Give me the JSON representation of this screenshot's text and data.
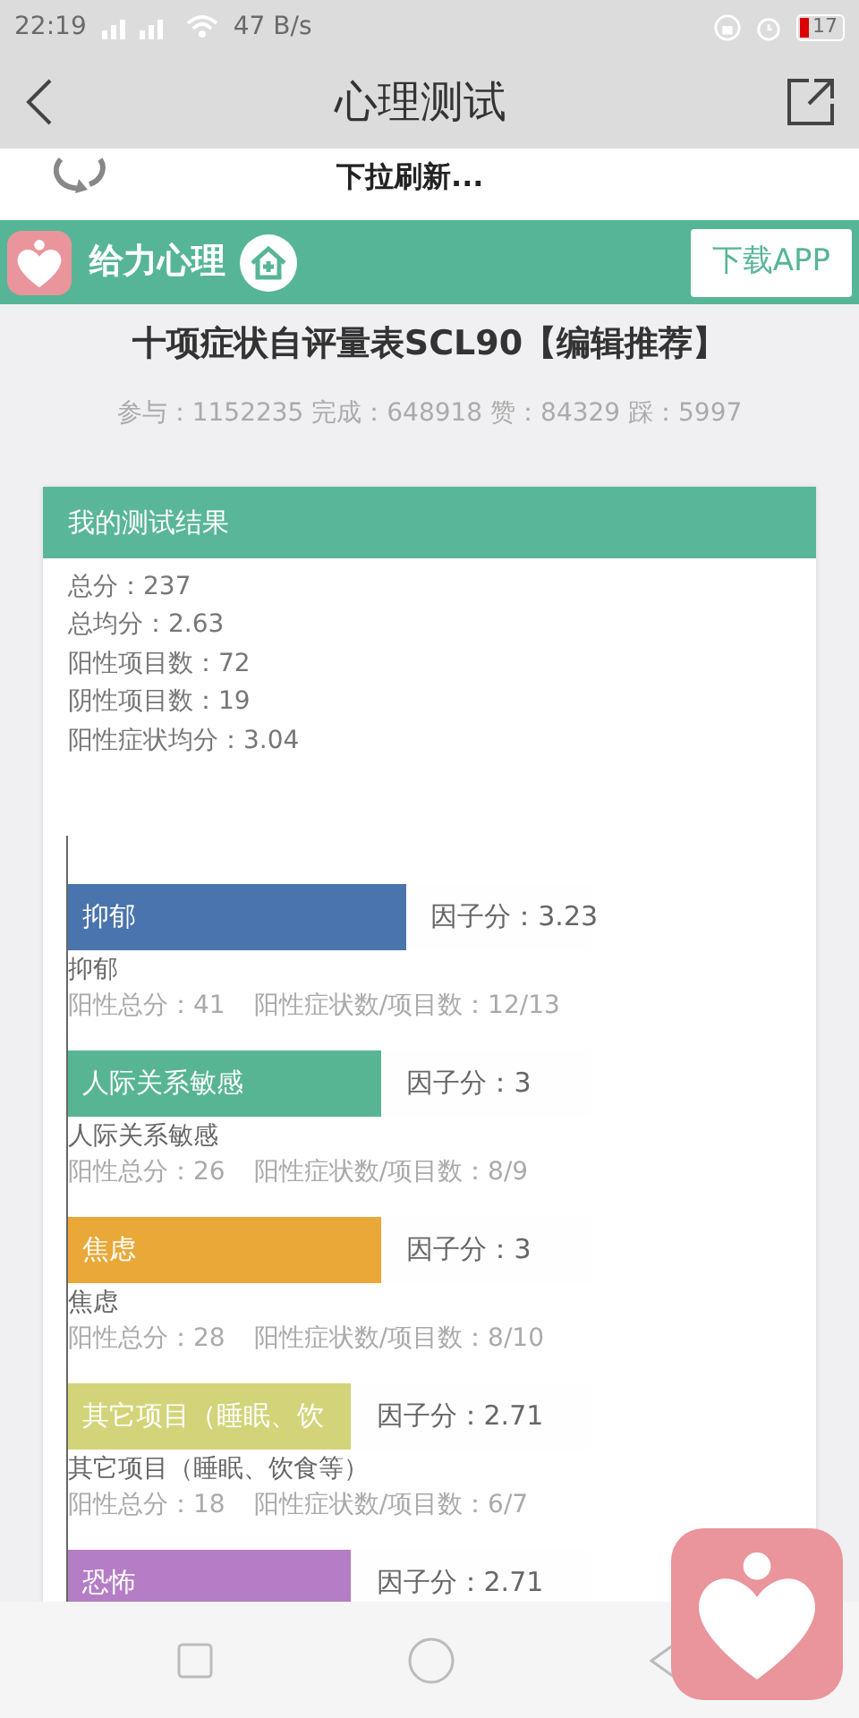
{
  "status_bar": {
    "time": "22:19",
    "speed": "47 B/s",
    "battery": "17"
  },
  "header": {
    "title": "心理测试"
  },
  "refresh": {
    "text": "下拉刷新..."
  },
  "banner": {
    "brand": "给力心理",
    "button": "下载APP"
  },
  "test": {
    "title": "十项症状自评量表SCL90【编辑推荐】",
    "stats": "参与：1152235 完成：648918 赞：84329 踩：5997"
  },
  "result": {
    "heading": "我的测试结果",
    "summary": [
      "总分：237",
      "总均分：2.63",
      "阳性项目数：72",
      "阴性项目数：19",
      "阳性症状均分：3.04"
    ],
    "factors": [
      {
        "bar_label": "抑郁",
        "color": "#4a74ad",
        "level": 0.646,
        "score": "因子分：3.23",
        "name": "抑郁",
        "positive_total": "阳性总分：41",
        "ratio": "阳性症状数/项目数：12/13"
      },
      {
        "bar_label": "人际关系敏感",
        "color": "#57b593",
        "level": 0.6,
        "score": "因子分：3",
        "name": "人际关系敏感",
        "positive_total": "阳性总分：26",
        "ratio": "阳性症状数/项目数：8/9"
      },
      {
        "bar_label": "焦虑",
        "color": "#e9a838",
        "level": 0.6,
        "score": "因子分：3",
        "name": "焦虑",
        "positive_total": "阳性总分：28",
        "ratio": "阳性症状数/项目数：8/10"
      },
      {
        "bar_label": "其它项目（睡眠、饮",
        "color": "#d3d47a",
        "level": 0.542,
        "score": "因子分：2.71",
        "name": "其它项目（睡眠、饮食等）",
        "positive_total": "阳性总分：18",
        "ratio": "阳性症状数/项目数：6/7"
      },
      {
        "bar_label": "恐怖",
        "color": "#b57dc5",
        "level": 0.542,
        "score": "因子分：2.71"
      }
    ]
  }
}
